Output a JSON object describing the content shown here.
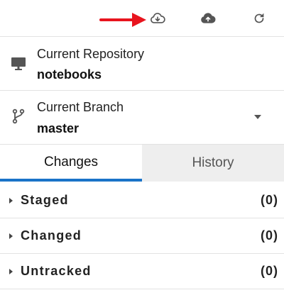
{
  "toolbar": {
    "buttons": [
      {
        "name": "pull-button",
        "icon": "cloud-download-icon"
      },
      {
        "name": "push-button",
        "icon": "cloud-upload-icon"
      },
      {
        "name": "refresh-button",
        "icon": "refresh-icon"
      }
    ],
    "annotation": {
      "icon": "red-arrow-icon",
      "color": "#e8141e"
    }
  },
  "repository": {
    "label": "Current Repository",
    "value": "notebooks",
    "icon": "monitor-icon"
  },
  "branch": {
    "label": "Current Branch",
    "value": "master",
    "icon": "git-branch-icon"
  },
  "tabs": [
    {
      "label": "Changes",
      "active": true
    },
    {
      "label": "History",
      "active": false
    }
  ],
  "groups": [
    {
      "name": "Staged",
      "count": "(0)"
    },
    {
      "name": "Changed",
      "count": "(0)"
    },
    {
      "name": "Untracked",
      "count": "(0)"
    }
  ],
  "colors": {
    "accent": "#1a73c8",
    "annotation": "#e8141e",
    "icon": "#555555"
  }
}
